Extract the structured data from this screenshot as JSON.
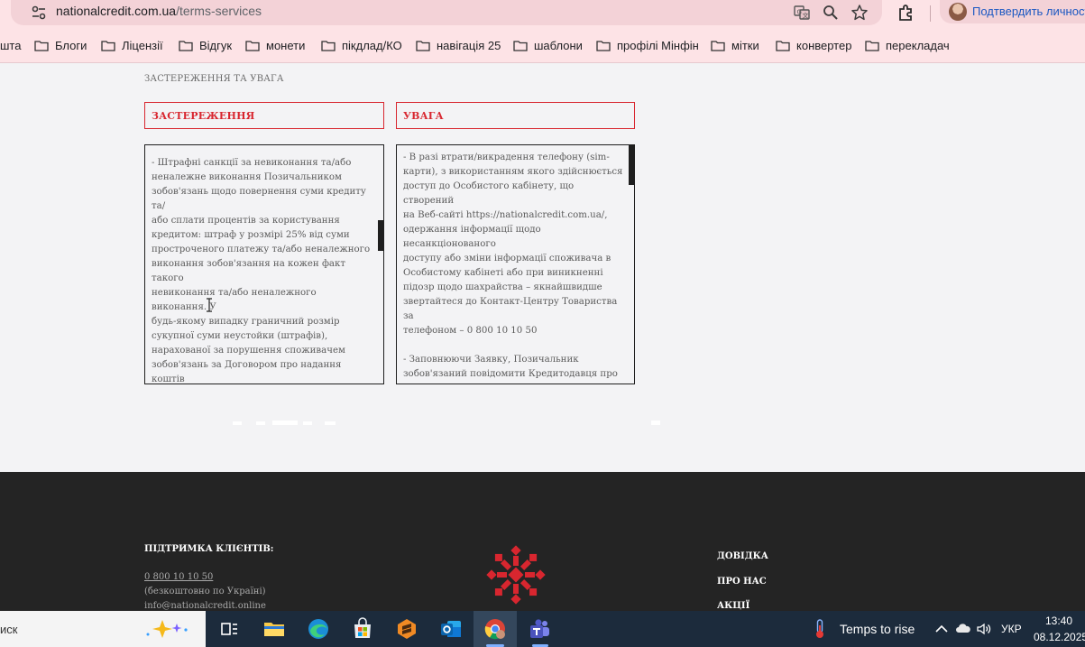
{
  "browser": {
    "url_host": "nationalcredit.com.ua",
    "url_path": "/terms-services",
    "profile_label": "Подтвердить личность"
  },
  "bookmarks": [
    "шта",
    "Блоги",
    "Ліцензії",
    "Відгук",
    "монети",
    "пікдлад/КО",
    "навігація 25",
    "шаблони",
    "профілі Мінфін",
    "мітки",
    "конвертер",
    "перекладач"
  ],
  "page": {
    "section_title": "ЗАСТЕРЕЖЕННЯ ТА УВАГА",
    "tab_left": "ЗАСТЕРЕЖЕННЯ",
    "tab_right": "УВАГА",
    "left_text": "- Штрафні санкції за невиконання та/або\nненалежне виконання Позичальником\nзобов'язань щодо повернення суми кредиту та/\nабо сплати процентів за користування\nкредитом: штраф у розмірі 25% від суми\nпростроченого платежу та/або неналежного\nвиконання зобов'язання на кожен факт такого\nневиконання та/або неналежного виконання. У\nбудь-якому випадку граничний розмір\nсукупної суми неустойки (штрафів),\nнарахованої за порушення споживачем\nзобов'язань за Договором про надання коштів\nна умовах споживчого кредиту, обмежується\nсумою, визначеною у відповідності до Закону\nУкраїни «Про споживче кредитування». У\nвипадку встановлення законодавством України",
    "right_text": "- В разі втрати/викрадення телефону (sim-\nкарти), з використанням якого здійснюється\nдоступ до Особистого кабінету, що створений\nна Веб-сайті https://nationalcredit.com.ua/,\nодержання інформації щодо несанкціонованого\nдоступу або зміни інформації споживача в\nОсобистому кабінеті або при виникненні\nпідозр щодо шахрайства – якнайшвидше\nзвертайтеся до Контакт-Центру Товариства за\nтелефоном – 0 800 10 10 50\n\n- Заповнюючи Заявку, Позичальник\nзобов'язаний повідомити Кредитодавця про\nнаявність кредитних пільг (для\nвійськовослужбовців з початку і до закінчення\nособливого періоду, резервістів та"
  },
  "footer": {
    "support_heading": "ПІДТРИМКА КЛІЄНТІВ:",
    "phone": "0 800 10 10 50",
    "phone_note": "(безкоштовно по Україні)",
    "email": "info@nationalcredit.online",
    "links": [
      "ДОВІДКА",
      "ПРО НАС",
      "АКЦІЇ"
    ],
    "logo_color": "#d8262f"
  },
  "taskbar": {
    "search_text": "иск",
    "weather_text": "Temps to rise",
    "lang": "УКР",
    "time": "13:40",
    "date": "08.12.2025"
  },
  "colors": {
    "accent_red": "#d8262f",
    "browser_pink": "#fde3e6",
    "footer_bg": "#242424",
    "taskbar_bg": "#1c2b3c"
  }
}
